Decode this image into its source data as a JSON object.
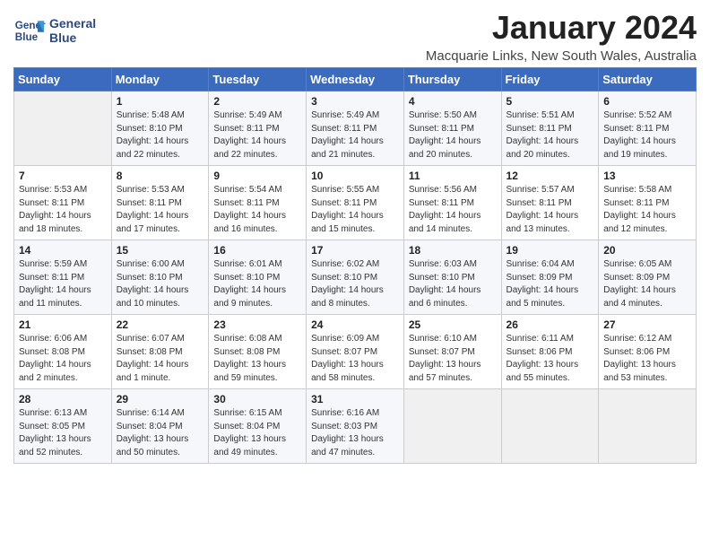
{
  "header": {
    "logo_line1": "General",
    "logo_line2": "Blue",
    "title": "January 2024",
    "subtitle": "Macquarie Links, New South Wales, Australia"
  },
  "days_of_week": [
    "Sunday",
    "Monday",
    "Tuesday",
    "Wednesday",
    "Thursday",
    "Friday",
    "Saturday"
  ],
  "weeks": [
    [
      {
        "day": "",
        "empty": true
      },
      {
        "day": "1",
        "sunrise": "5:48 AM",
        "sunset": "8:10 PM",
        "daylight": "14 hours and 22 minutes."
      },
      {
        "day": "2",
        "sunrise": "5:49 AM",
        "sunset": "8:11 PM",
        "daylight": "14 hours and 22 minutes."
      },
      {
        "day": "3",
        "sunrise": "5:49 AM",
        "sunset": "8:11 PM",
        "daylight": "14 hours and 21 minutes."
      },
      {
        "day": "4",
        "sunrise": "5:50 AM",
        "sunset": "8:11 PM",
        "daylight": "14 hours and 20 minutes."
      },
      {
        "day": "5",
        "sunrise": "5:51 AM",
        "sunset": "8:11 PM",
        "daylight": "14 hours and 20 minutes."
      },
      {
        "day": "6",
        "sunrise": "5:52 AM",
        "sunset": "8:11 PM",
        "daylight": "14 hours and 19 minutes."
      }
    ],
    [
      {
        "day": "7",
        "sunrise": "5:53 AM",
        "sunset": "8:11 PM",
        "daylight": "14 hours and 18 minutes."
      },
      {
        "day": "8",
        "sunrise": "5:53 AM",
        "sunset": "8:11 PM",
        "daylight": "14 hours and 17 minutes."
      },
      {
        "day": "9",
        "sunrise": "5:54 AM",
        "sunset": "8:11 PM",
        "daylight": "14 hours and 16 minutes."
      },
      {
        "day": "10",
        "sunrise": "5:55 AM",
        "sunset": "8:11 PM",
        "daylight": "14 hours and 15 minutes."
      },
      {
        "day": "11",
        "sunrise": "5:56 AM",
        "sunset": "8:11 PM",
        "daylight": "14 hours and 14 minutes."
      },
      {
        "day": "12",
        "sunrise": "5:57 AM",
        "sunset": "8:11 PM",
        "daylight": "14 hours and 13 minutes."
      },
      {
        "day": "13",
        "sunrise": "5:58 AM",
        "sunset": "8:11 PM",
        "daylight": "14 hours and 12 minutes."
      }
    ],
    [
      {
        "day": "14",
        "sunrise": "5:59 AM",
        "sunset": "8:11 PM",
        "daylight": "14 hours and 11 minutes."
      },
      {
        "day": "15",
        "sunrise": "6:00 AM",
        "sunset": "8:10 PM",
        "daylight": "14 hours and 10 minutes."
      },
      {
        "day": "16",
        "sunrise": "6:01 AM",
        "sunset": "8:10 PM",
        "daylight": "14 hours and 9 minutes."
      },
      {
        "day": "17",
        "sunrise": "6:02 AM",
        "sunset": "8:10 PM",
        "daylight": "14 hours and 8 minutes."
      },
      {
        "day": "18",
        "sunrise": "6:03 AM",
        "sunset": "8:10 PM",
        "daylight": "14 hours and 6 minutes."
      },
      {
        "day": "19",
        "sunrise": "6:04 AM",
        "sunset": "8:09 PM",
        "daylight": "14 hours and 5 minutes."
      },
      {
        "day": "20",
        "sunrise": "6:05 AM",
        "sunset": "8:09 PM",
        "daylight": "14 hours and 4 minutes."
      }
    ],
    [
      {
        "day": "21",
        "sunrise": "6:06 AM",
        "sunset": "8:08 PM",
        "daylight": "14 hours and 2 minutes."
      },
      {
        "day": "22",
        "sunrise": "6:07 AM",
        "sunset": "8:08 PM",
        "daylight": "14 hours and 1 minute."
      },
      {
        "day": "23",
        "sunrise": "6:08 AM",
        "sunset": "8:08 PM",
        "daylight": "13 hours and 59 minutes."
      },
      {
        "day": "24",
        "sunrise": "6:09 AM",
        "sunset": "8:07 PM",
        "daylight": "13 hours and 58 minutes."
      },
      {
        "day": "25",
        "sunrise": "6:10 AM",
        "sunset": "8:07 PM",
        "daylight": "13 hours and 57 minutes."
      },
      {
        "day": "26",
        "sunrise": "6:11 AM",
        "sunset": "8:06 PM",
        "daylight": "13 hours and 55 minutes."
      },
      {
        "day": "27",
        "sunrise": "6:12 AM",
        "sunset": "8:06 PM",
        "daylight": "13 hours and 53 minutes."
      }
    ],
    [
      {
        "day": "28",
        "sunrise": "6:13 AM",
        "sunset": "8:05 PM",
        "daylight": "13 hours and 52 minutes."
      },
      {
        "day": "29",
        "sunrise": "6:14 AM",
        "sunset": "8:04 PM",
        "daylight": "13 hours and 50 minutes."
      },
      {
        "day": "30",
        "sunrise": "6:15 AM",
        "sunset": "8:04 PM",
        "daylight": "13 hours and 49 minutes."
      },
      {
        "day": "31",
        "sunrise": "6:16 AM",
        "sunset": "8:03 PM",
        "daylight": "13 hours and 47 minutes."
      },
      {
        "day": "",
        "empty": true
      },
      {
        "day": "",
        "empty": true
      },
      {
        "day": "",
        "empty": true
      }
    ]
  ]
}
